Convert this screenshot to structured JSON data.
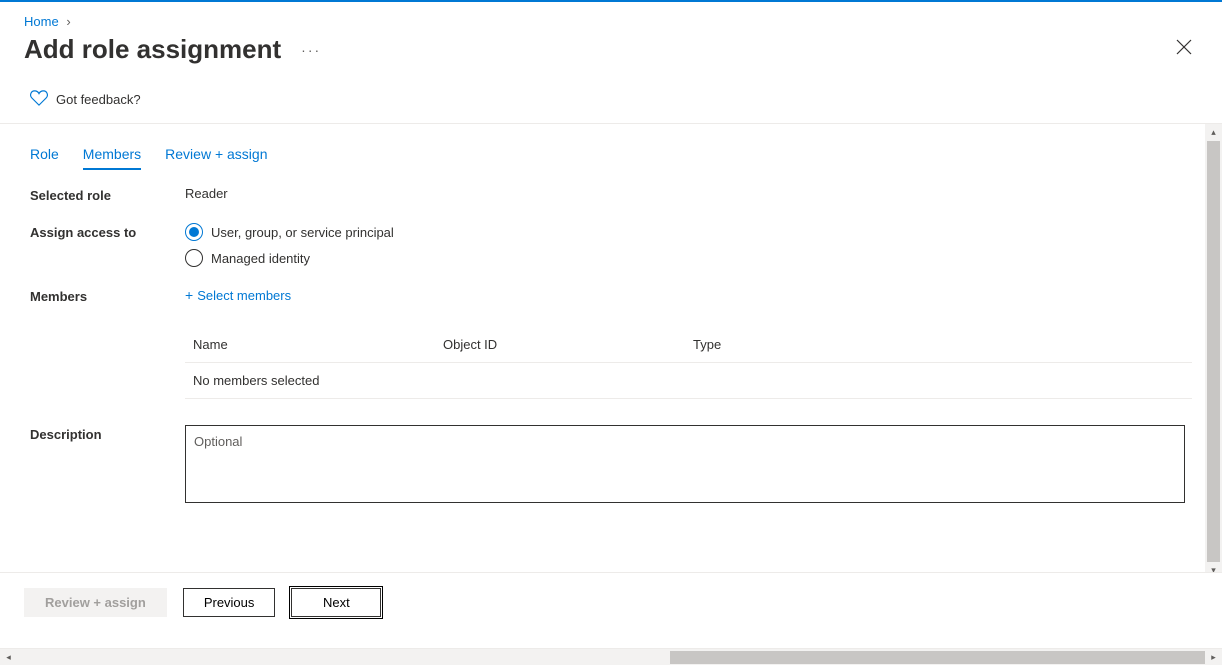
{
  "breadcrumb": {
    "home": "Home"
  },
  "header": {
    "title": "Add role assignment"
  },
  "feedback": {
    "label": "Got feedback?"
  },
  "tabs": [
    {
      "label": "Role",
      "active": false
    },
    {
      "label": "Members",
      "active": true
    },
    {
      "label": "Review + assign",
      "active": false
    }
  ],
  "form": {
    "selected_role_label": "Selected role",
    "selected_role_value": "Reader",
    "assign_access_label": "Assign access to",
    "assign_options": {
      "user_group": "User, group, or service principal",
      "managed_identity": "Managed identity"
    },
    "members_label": "Members",
    "select_members_link": "Select members",
    "table": {
      "col_name": "Name",
      "col_objectid": "Object ID",
      "col_type": "Type",
      "empty": "No members selected"
    },
    "description_label": "Description",
    "description_placeholder": "Optional"
  },
  "footer": {
    "review_assign": "Review + assign",
    "previous": "Previous",
    "next": "Next"
  }
}
